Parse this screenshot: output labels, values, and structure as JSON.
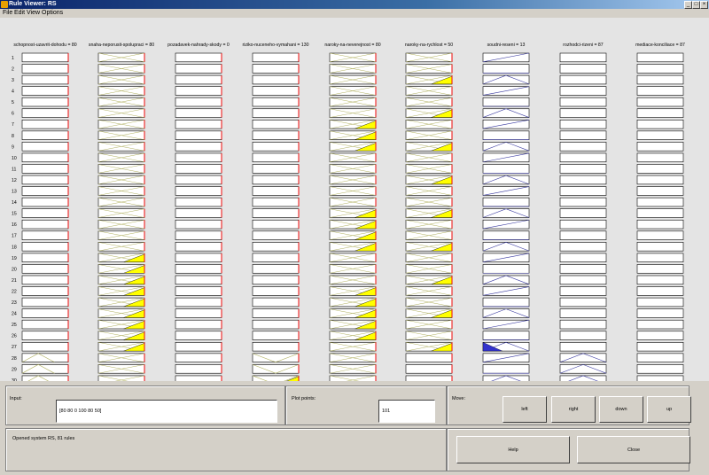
{
  "window": {
    "title": "Rule Viewer: RS"
  },
  "window_controls": {
    "minimize": "_",
    "maximize": "□",
    "close": "×"
  },
  "menu": [
    "File",
    "Edit",
    "View",
    "Options"
  ],
  "variables": [
    {
      "label": "schopnost-uzavrit-dohodu = 80",
      "kind": "input",
      "pos": 0.72
    },
    {
      "label": "snaha-neporusit-spolupraci = 80",
      "kind": "input",
      "pos": 0.72
    },
    {
      "label": "pozadavek-nahrady-skody = 0",
      "kind": "input",
      "pos": 0.0
    },
    {
      "label": "riziko-nuceneho-vymahani = 130",
      "kind": "input",
      "pos": 1.0
    },
    {
      "label": "naroky-na-neverejnost = 80",
      "kind": "input",
      "pos": 0.72
    },
    {
      "label": "naroky-na-rychlost = 50",
      "kind": "input",
      "pos": 0.72
    },
    {
      "label": "soudni-reseni = 13",
      "kind": "output"
    },
    {
      "label": "rozhodci-rizeni = 87",
      "kind": "output"
    },
    {
      "label": "mediace-konciliace = 87",
      "kind": "output"
    }
  ],
  "rows": {
    "count": 30,
    "labels": [
      "1",
      "2",
      "3",
      "4",
      "5",
      "6",
      "7",
      "8",
      "9",
      "10",
      "11",
      "12",
      "13",
      "14",
      "15",
      "16",
      "17",
      "18",
      "19",
      "20",
      "21",
      "22",
      "23",
      "24",
      "25",
      "26",
      "27",
      "28",
      "29",
      "30"
    ]
  },
  "colors": {
    "fill_input": "#ffff00",
    "fill_output": "#3333cc",
    "line_input": "#b0b060",
    "line_output": "#3a3aa0",
    "red_line": "#ff0000"
  },
  "panels": {
    "input": {
      "label": "Input:",
      "value": "[80 80 0 100 80 50]"
    },
    "plot_points": {
      "label": "Plot points:",
      "value": "101"
    },
    "move": {
      "label": "Move:",
      "buttons": [
        "left",
        "right",
        "down",
        "up"
      ]
    },
    "status": {
      "text": "Opened system RS, 81 rules"
    },
    "help_label": "Help",
    "close_label": "Close"
  }
}
